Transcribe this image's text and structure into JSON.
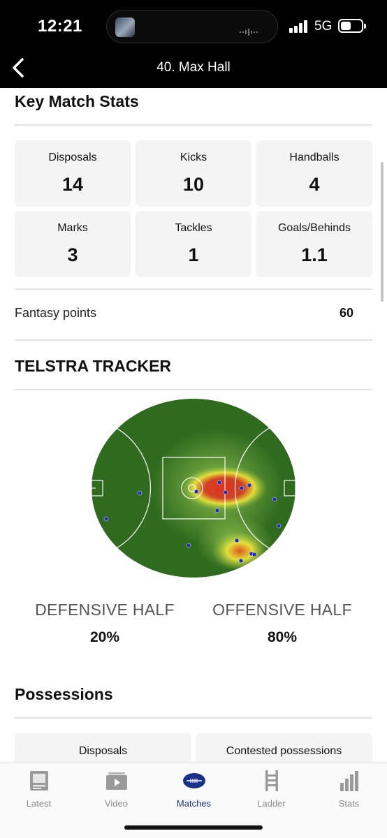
{
  "status_bar": {
    "time": "12:21",
    "network": "5G"
  },
  "nav": {
    "title": "40. Max Hall"
  },
  "key_stats": {
    "title": "Key Match Stats",
    "items": [
      {
        "label": "Disposals",
        "value": "14"
      },
      {
        "label": "Kicks",
        "value": "10"
      },
      {
        "label": "Handballs",
        "value": "4"
      },
      {
        "label": "Marks",
        "value": "3"
      },
      {
        "label": "Tackles",
        "value": "1"
      },
      {
        "label": "Goals/Behinds",
        "value": "1.1"
      }
    ]
  },
  "fantasy": {
    "label": "Fantasy points",
    "value": "60"
  },
  "tracker": {
    "title": "TELSTRA TRACKER",
    "defensive_label": "DEFENSIVE HALF",
    "defensive_value": "20%",
    "offensive_label": "OFFENSIVE HALF",
    "offensive_value": "80%",
    "colors": {
      "field": "#2f6a1f",
      "hot": "#e0301e",
      "warm": "#f2e63a",
      "dot": "#1c2fb8"
    }
  },
  "possessions": {
    "title": "Possessions",
    "cards": [
      {
        "label": "Disposals"
      },
      {
        "label": "Contested possessions"
      }
    ]
  },
  "tabbar": {
    "active_color": "#1a2f8a",
    "tabs": [
      {
        "label": "Latest",
        "icon": "latest-icon"
      },
      {
        "label": "Video",
        "icon": "video-icon"
      },
      {
        "label": "Matches",
        "icon": "football-icon"
      },
      {
        "label": "Ladder",
        "icon": "ladder-icon"
      },
      {
        "label": "Stats",
        "icon": "stats-icon"
      }
    ]
  }
}
